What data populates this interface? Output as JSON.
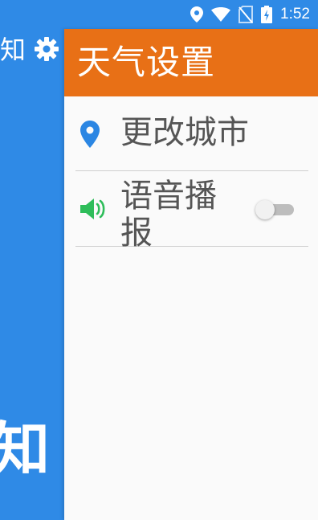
{
  "status_bar": {
    "time": "1:52",
    "icons": [
      "location-icon",
      "wifi-icon",
      "no-sim-icon",
      "battery-charging-icon"
    ]
  },
  "background_app": {
    "title": "知",
    "big_text": "知",
    "icon": "gear-icon"
  },
  "panel": {
    "title": "天气设置",
    "rows": [
      {
        "label": "更改城市",
        "icon": "location-pin-icon"
      },
      {
        "label": "语音播报",
        "icon": "speaker-icon",
        "toggle_on": false
      }
    ]
  },
  "colors": {
    "header": "#e87016",
    "background_blue": "#2f8ae6",
    "pin": "#2b86e3",
    "speaker": "#2ebd5a"
  }
}
